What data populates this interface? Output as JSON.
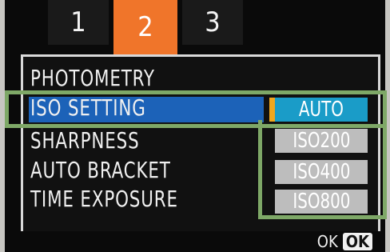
{
  "tabs": [
    {
      "label": "1"
    },
    {
      "label": "2"
    },
    {
      "label": "3"
    }
  ],
  "menu": {
    "items": [
      {
        "label": "PHOTOMETRY"
      },
      {
        "label": "ISO SETTING"
      },
      {
        "label": "SHARPNESS"
      },
      {
        "label": "AUTO BRACKET"
      },
      {
        "label": "TIME EXPOSURE"
      }
    ],
    "selected": "ISO SETTING"
  },
  "iso_options": [
    {
      "label": "AUTO"
    },
    {
      "label": "ISO200"
    },
    {
      "label": "ISO400"
    },
    {
      "label": "ISO800"
    }
  ],
  "footer": {
    "ok_label": "OK",
    "ok_button": "OK"
  },
  "colors": {
    "active_tab": "#f0752a",
    "selection_bar": "#1c62b8",
    "selected_option": "#1a9cc8",
    "highlight_outline": "#7ea867"
  }
}
